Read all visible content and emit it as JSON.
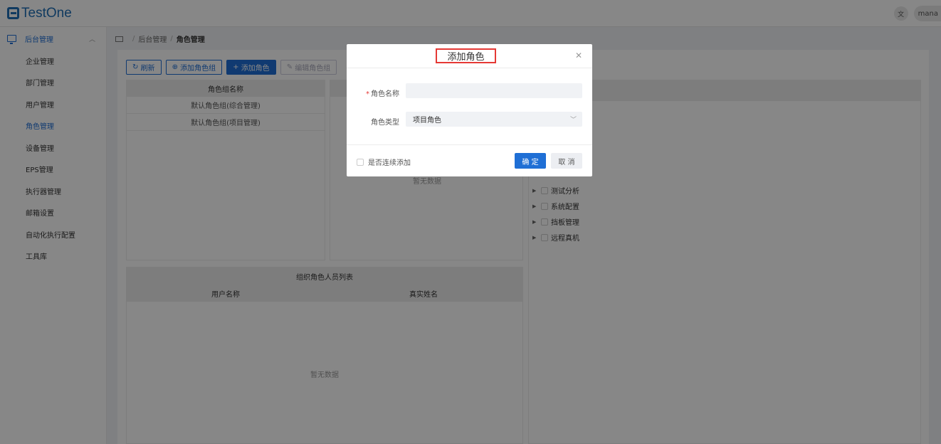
{
  "app": {
    "logo_text": "TestOne",
    "lang_icon": "translate-icon",
    "user_label": "mana"
  },
  "sidebar": {
    "group_label": "后台管理",
    "group_icon": "monitor-icon",
    "items": [
      {
        "label": "企业管理",
        "active": false
      },
      {
        "label": "部门管理",
        "active": false
      },
      {
        "label": "用户管理",
        "active": false
      },
      {
        "label": "角色管理",
        "active": true
      },
      {
        "label": "设备管理",
        "active": false
      },
      {
        "label": "EPS管理",
        "active": false
      },
      {
        "label": "执行器管理",
        "active": false
      },
      {
        "label": "邮箱设置",
        "active": false
      },
      {
        "label": "自动化执行配置",
        "active": false
      },
      {
        "label": "工具库",
        "active": false
      }
    ]
  },
  "breadcrumb": {
    "items": [
      "后台管理",
      "角色管理"
    ]
  },
  "toolbar": {
    "refresh": "刷新",
    "add_group": "添加角色组",
    "add_role": "添加角色",
    "edit_group": "编辑角色组"
  },
  "role_group_table": {
    "header": "角色组名称",
    "rows": [
      "默认角色组(综合管理)",
      "默认角色组(项目管理)"
    ]
  },
  "role_table": {
    "empty_text": "暂无数据"
  },
  "members_table": {
    "title": "组织角色人员列表",
    "columns": [
      "用户名称",
      "真实姓名"
    ],
    "empty_text": "暂无数据"
  },
  "permission_tree": [
    "测试分析",
    "系统配置",
    "挡板管理",
    "远程真机"
  ],
  "modal": {
    "title": "添加角色",
    "name_label": "角色名称",
    "name_value": "",
    "type_label": "角色类型",
    "type_value": "项目角色",
    "continuous_label": "是否连续添加",
    "ok": "确 定",
    "cancel": "取 消",
    "highlight_color": "#e53935",
    "primary_color": "#1f6fd5"
  }
}
